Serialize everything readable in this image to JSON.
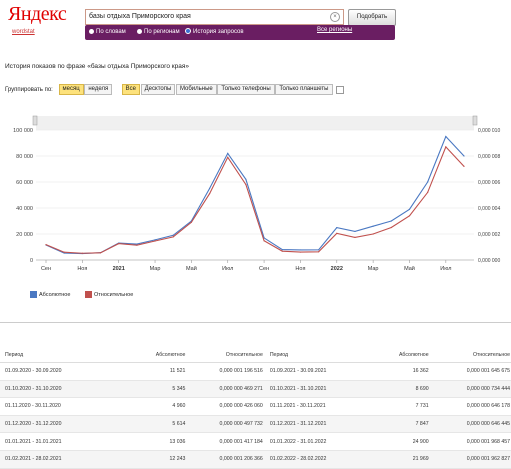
{
  "header": {
    "logo": "Яндекс",
    "wordstat": "wordstat",
    "query": "базы отдыха Приморского края",
    "search_button": "Подобрать",
    "modes": [
      {
        "label": "По словам",
        "selected": false
      },
      {
        "label": "По регионам",
        "selected": false
      },
      {
        "label": "История запросов",
        "selected": true
      }
    ],
    "all_regions": "Все регионы"
  },
  "page_title": "История показов по фразе «базы отдыха Приморского края»",
  "grouping": {
    "label": "Группировать по:",
    "period_options": [
      {
        "label": "месяц",
        "active": true
      },
      {
        "label": "неделя",
        "active": false
      }
    ],
    "device_options": [
      {
        "label": "Все",
        "active": true
      },
      {
        "label": "Десктопы",
        "active": false
      },
      {
        "label": "Мобильные",
        "active": false
      },
      {
        "label": "Только телефоны",
        "active": false
      },
      {
        "label": "Только планшеты",
        "active": false
      }
    ]
  },
  "chart_data": {
    "type": "line",
    "x": [
      "Сен",
      "Окт",
      "Ноя",
      "Дек",
      "2021",
      "Фев",
      "Мар",
      "Апр",
      "Май",
      "Июн",
      "Июл",
      "Авг",
      "Сен",
      "Окт",
      "Ноя",
      "Дек",
      "2022",
      "Фев",
      "Мар",
      "Апр",
      "Май",
      "Июн",
      "Июл",
      "Авг"
    ],
    "x_tick_labels": [
      "Сен",
      "Ноя",
      "2021",
      "Мар",
      "Май",
      "Июл",
      "Сен",
      "Ноя",
      "2022",
      "Мар",
      "Май",
      "Июл"
    ],
    "yleft_ticks": [
      "0",
      "20 000",
      "40 000",
      "60 000",
      "80 000",
      "100 000"
    ],
    "yright_ticks": [
      "0,000 000",
      "0,000 002",
      "0,000 004",
      "0,000 006",
      "0,000 008",
      "0,000 010"
    ],
    "ylim": [
      0,
      100000
    ],
    "series": [
      {
        "name": "Абсолютное",
        "color": "#4a78c2",
        "values": [
          11521,
          5345,
          4960,
          5614,
          13036,
          12243,
          15500,
          19000,
          30000,
          55000,
          82000,
          62000,
          17000,
          8000,
          7731,
          7847,
          24900,
          21969,
          26000,
          30000,
          39000,
          60000,
          95000,
          80000
        ]
      },
      {
        "name": "Относительное",
        "color": "#c0504d",
        "values": [
          11800,
          6000,
          5200,
          5500,
          12600,
          11400,
          14600,
          17800,
          29000,
          51000,
          79000,
          58000,
          14800,
          6800,
          6100,
          6300,
          20500,
          17400,
          20000,
          25000,
          34000,
          52000,
          87000,
          72000
        ]
      }
    ]
  },
  "table": {
    "headers": [
      "Период",
      "Абсолютное",
      "Относительное",
      "Период",
      "Абсолютное",
      "Относительное"
    ],
    "rows": [
      [
        "01.09.2020 - 30.09.2020",
        "11 521",
        "0,000 001 196 516",
        "01.09.2021 - 30.09.2021",
        "16 362",
        "0,000 001 645 675"
      ],
      [
        "01.10.2020 - 31.10.2020",
        "5 345",
        "0,000 000 469 271",
        "01.10.2021 - 31.10.2021",
        "8 690",
        "0,000 000 734 444"
      ],
      [
        "01.11.2020 - 30.11.2020",
        "4 960",
        "0,000 000 426 060",
        "01.11.2021 - 30.11.2021",
        "7 731",
        "0,000 000 646 178"
      ],
      [
        "01.12.2020 - 31.12.2020",
        "5 614",
        "0,000 000 497 732",
        "01.12.2021 - 31.12.2021",
        "7 847",
        "0,000 000 646 445"
      ],
      [
        "01.01.2021 - 31.01.2021",
        "13 036",
        "0,000 001 417 184",
        "01.01.2022 - 31.01.2022",
        "24 900",
        "0,000 001 968 457"
      ],
      [
        "01.02.2021 - 28.02.2021",
        "12 243",
        "0,000 001 206 366",
        "01.02.2022 - 28.02.2022",
        "21 969",
        "0,000 001 962 827"
      ]
    ]
  }
}
